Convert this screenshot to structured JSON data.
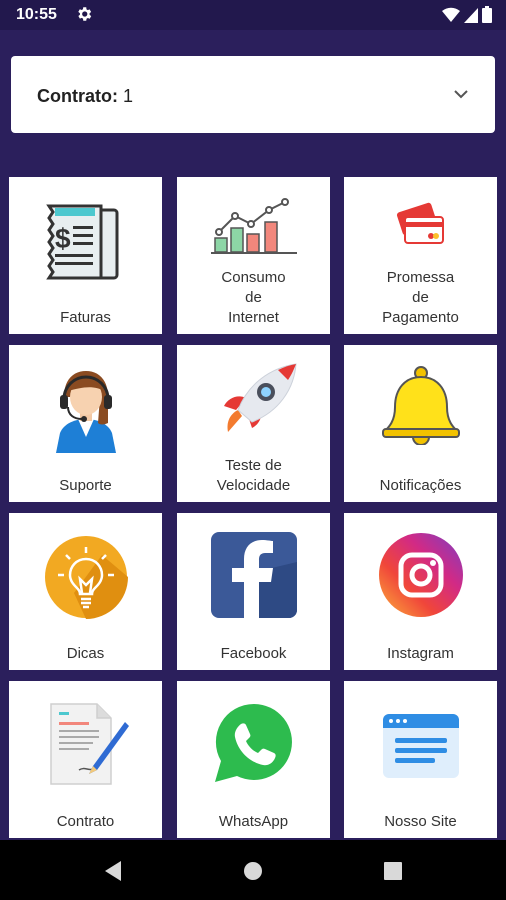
{
  "status": {
    "time": "10:55"
  },
  "contract": {
    "label": "Contrato:",
    "value": "1"
  },
  "tiles": [
    {
      "label": "Faturas",
      "icon": "invoice-icon"
    },
    {
      "label": "Consumo\nde\nInternet",
      "icon": "bar-chart-icon"
    },
    {
      "label": "Promessa\nde\nPagamento",
      "icon": "credit-card-icon"
    },
    {
      "label": "Suporte",
      "icon": "support-agent-icon"
    },
    {
      "label": "Teste de\nVelocidade",
      "icon": "rocket-icon"
    },
    {
      "label": "Notificações",
      "icon": "bell-icon"
    },
    {
      "label": "Dicas",
      "icon": "lightbulb-icon"
    },
    {
      "label": "Facebook",
      "icon": "facebook-icon"
    },
    {
      "label": "Instagram",
      "icon": "instagram-icon"
    },
    {
      "label": "Contrato",
      "icon": "contract-document-icon"
    },
    {
      "label": "WhatsApp",
      "icon": "whatsapp-icon"
    },
    {
      "label": "Nosso Site",
      "icon": "website-icon"
    }
  ],
  "colors": {
    "background": "#2b1f5c",
    "statusbar": "#22184d",
    "navbar": "#000000"
  }
}
